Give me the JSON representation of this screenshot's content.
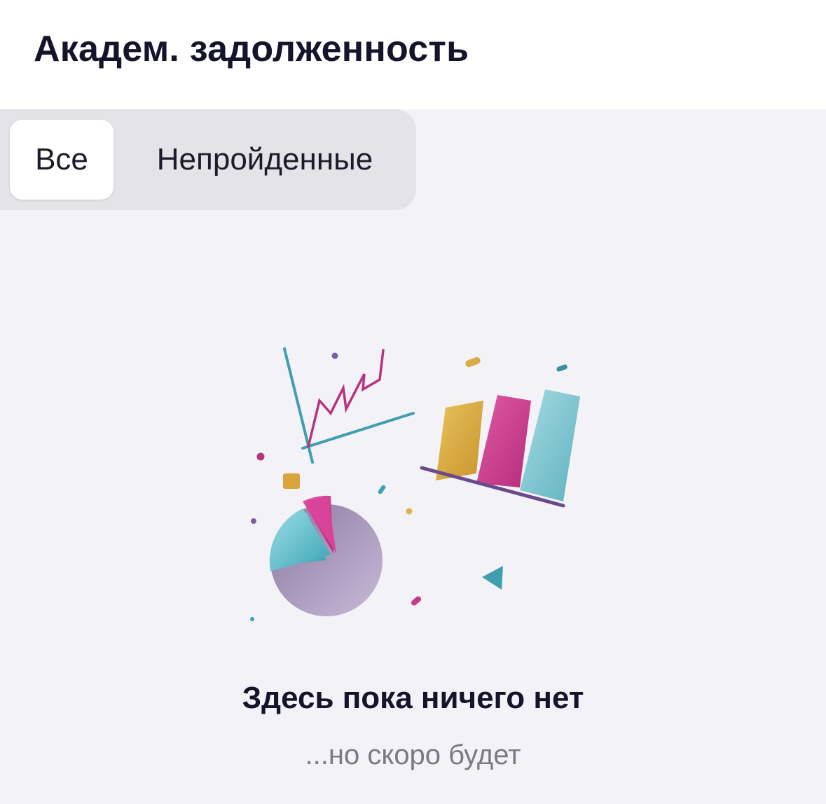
{
  "header": {
    "title": "Академ. задолженность"
  },
  "tabs": [
    {
      "label": "Все",
      "selected": true
    },
    {
      "label": "Непройденные",
      "selected": false
    }
  ],
  "empty_state": {
    "title": "Здесь пока ничего нет",
    "subtitle": "...но скоро будет",
    "illustration": "charts-illustration"
  },
  "colors": {
    "title": "#14142b",
    "subtitle": "#7a7a85",
    "background": "#f3f2f7",
    "segment_bg": "#e3e3e8",
    "teal": "#3aa3b3",
    "magenta": "#c8388a",
    "gold": "#e0b246",
    "purple": "#7b5ea8"
  }
}
